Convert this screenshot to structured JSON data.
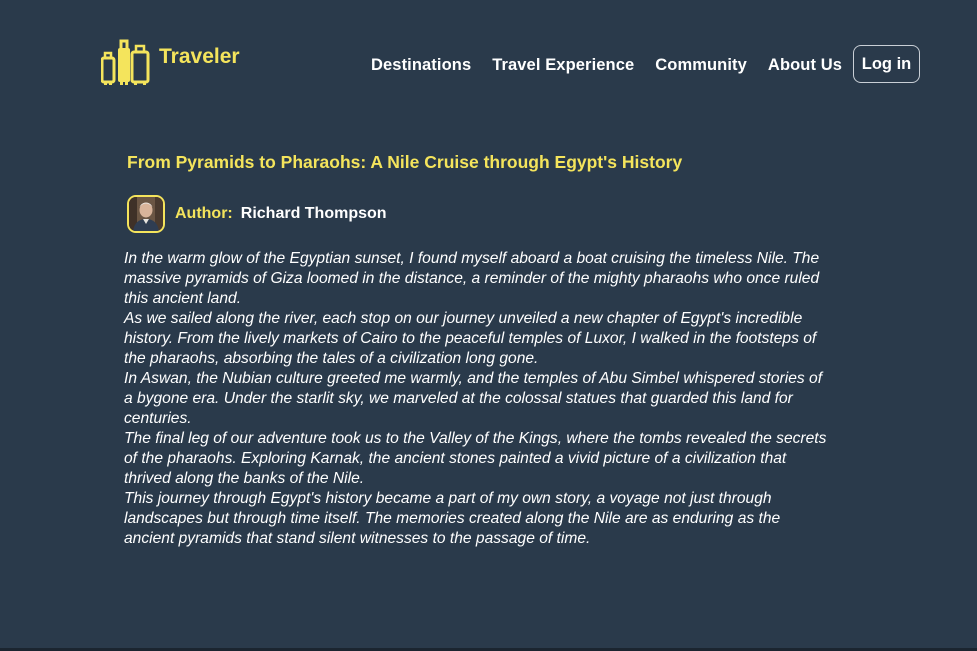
{
  "brand": {
    "name": "Traveler",
    "icon": "luggage-icon"
  },
  "nav": {
    "items": [
      {
        "label": "Destinations"
      },
      {
        "label": "Travel Experience"
      },
      {
        "label": "Community"
      },
      {
        "label": "About Us"
      }
    ],
    "login_label": "Log in"
  },
  "article": {
    "title": "From Pyramids to Pharaohs: A Nile Cruise through Egypt's History",
    "author_label": "Author:",
    "author_name": "Richard Thompson",
    "paragraphs": [
      "In the warm glow of the Egyptian sunset, I found myself aboard a boat cruising the timeless Nile. The massive pyramids of Giza loomed in the distance, a reminder of the mighty pharaohs who once ruled this ancient land.",
      "As we sailed along the river, each stop on our journey unveiled a new chapter of Egypt's incredible history. From the lively markets of Cairo to the peaceful temples of Luxor, I walked in the footsteps of the pharaohs, absorbing the tales of a civilization long gone.",
      "In Aswan, the Nubian culture greeted me warmly, and the temples of Abu Simbel whispered stories of a bygone era. Under the starlit sky, we marveled at the colossal statues that guarded this land for centuries.",
      "The final leg of our adventure took us to the Valley of the Kings, where the tombs revealed the secrets of the pharaohs. Exploring Karnak, the ancient stones painted a vivid picture of a civilization that thrived along the banks of the Nile.",
      "This journey through Egypt's history became a part of my own story, a voyage not just through landscapes but through time itself. The memories created along the Nile are as enduring as the ancient pyramids that stand silent witnesses to the passage of time."
    ]
  },
  "colors": {
    "background": "#2a3a4b",
    "accent": "#f4e45c",
    "text": "#ffffff"
  }
}
